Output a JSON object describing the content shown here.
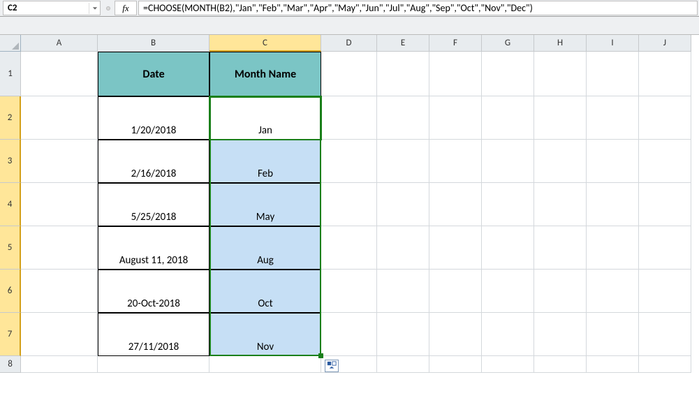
{
  "name_box": "C2",
  "fx_label": "fx",
  "formula": "=CHOOSE(MONTH(B2),\"Jan\",\"Feb\",\"Mar\",\"Apr\",\"May\",\"Jun\",\"Jul\",\"Aug\",\"Sep\",\"Oct\",\"Nov\",\"Dec\")",
  "columns": [
    "A",
    "B",
    "C",
    "D",
    "E",
    "F",
    "G",
    "H",
    "I",
    "J"
  ],
  "rows": [
    "1",
    "2",
    "3",
    "4",
    "5",
    "6",
    "7",
    "8"
  ],
  "headers": {
    "date": "Date",
    "month": "Month Name"
  },
  "data": {
    "dates": [
      "1/20/2018",
      "2/16/2018",
      "5/25/2018",
      "August 11, 2018",
      "20-Oct-2018",
      "27/11/2018"
    ],
    "months": [
      "Jan",
      "Feb",
      "May",
      "Aug",
      "Oct",
      "Nov"
    ]
  },
  "active_cell": "C2",
  "selection_range": "C2:C7",
  "selected_column": "C",
  "colors": {
    "header_fill": "#7bc5c5",
    "shade_fill": "#c6dff5",
    "selection_border": "#1a7f1a",
    "col_sel_fill": "#ffe699"
  }
}
